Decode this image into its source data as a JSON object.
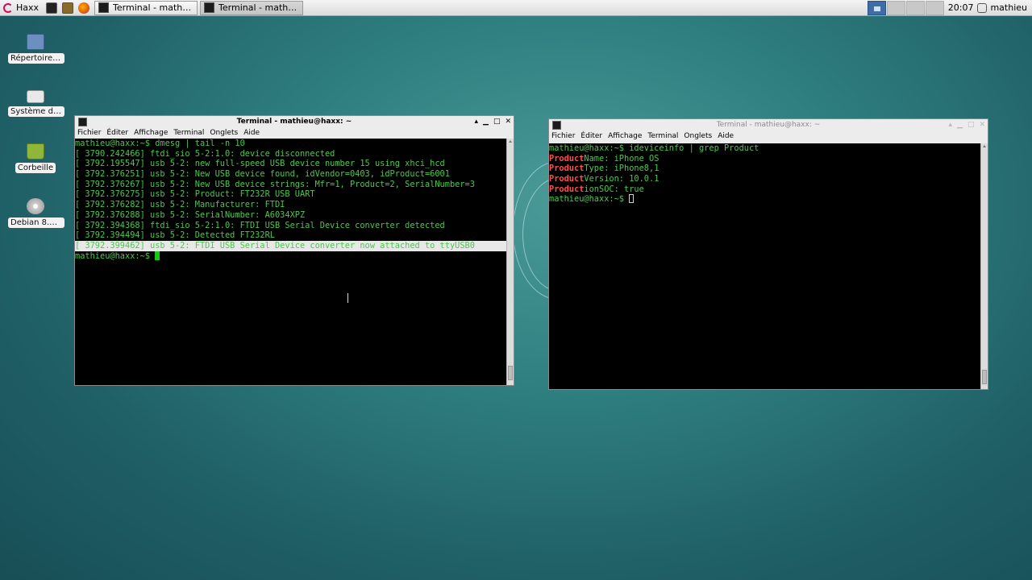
{
  "panel": {
    "menu_label": "Haxx",
    "tasks": [
      {
        "label": "Terminal - mathieu@ha..."
      },
      {
        "label": "Terminal - mathieu@ha..."
      }
    ],
    "clock": "20:07",
    "username": "mathieu"
  },
  "desktop_icons": [
    {
      "label": "Répertoire ...",
      "icon": "home-folder-icon"
    },
    {
      "label": "Système de...",
      "icon": "drive-icon"
    },
    {
      "label": "Corbeille",
      "icon": "trash-icon"
    },
    {
      "label": "Debian 8.4....",
      "icon": "disc-icon"
    }
  ],
  "menus": {
    "fichier": "Fichier",
    "editer": "Éditer",
    "affichage": "Affichage",
    "terminal": "Terminal",
    "onglets": "Onglets",
    "aide": "Aide"
  },
  "left_window": {
    "title": "Terminal - mathieu@haxx: ~",
    "lines": [
      "mathieu@haxx:~$ dmesg | tail -n 10",
      "[ 3790.242466] ftdi_sio 5-2:1.0: device disconnected",
      "[ 3792.195547] usb 5-2: new full-speed USB device number 15 using xhci_hcd",
      "[ 3792.376251] usb 5-2: New USB device found, idVendor=0403, idProduct=6001",
      "[ 3792.376267] usb 5-2: New USB device strings: Mfr=1, Product=2, SerialNumber=3",
      "[ 3792.376275] usb 5-2: Product: FT232R USB UART",
      "[ 3792.376282] usb 5-2: Manufacturer: FTDI",
      "[ 3792.376288] usb 5-2: SerialNumber: A6034XPZ",
      "[ 3792.394368] ftdi_sio 5-2:1.0: FTDI USB Serial Device converter detected",
      "[ 3792.394494] usb 5-2: Detected FT232RL",
      "[ 3792.399462] usb 5-2: FTDI USB Serial Device converter now attached to ttyUSB0"
    ],
    "prompt": "mathieu@haxx:~$ "
  },
  "right_window": {
    "title": "Terminal - mathieu@haxx: ~",
    "command_line": "mathieu@haxx:~$ ideviceinfo | grep Product",
    "match_word": "Product",
    "results": [
      {
        "rest": "Name: iPhone OS"
      },
      {
        "rest": "Type: iPhone8,1"
      },
      {
        "rest": "Version: 10.0.1"
      },
      {
        "rest": "ionSOC: true"
      }
    ],
    "prompt": "mathieu@haxx:~$ "
  }
}
